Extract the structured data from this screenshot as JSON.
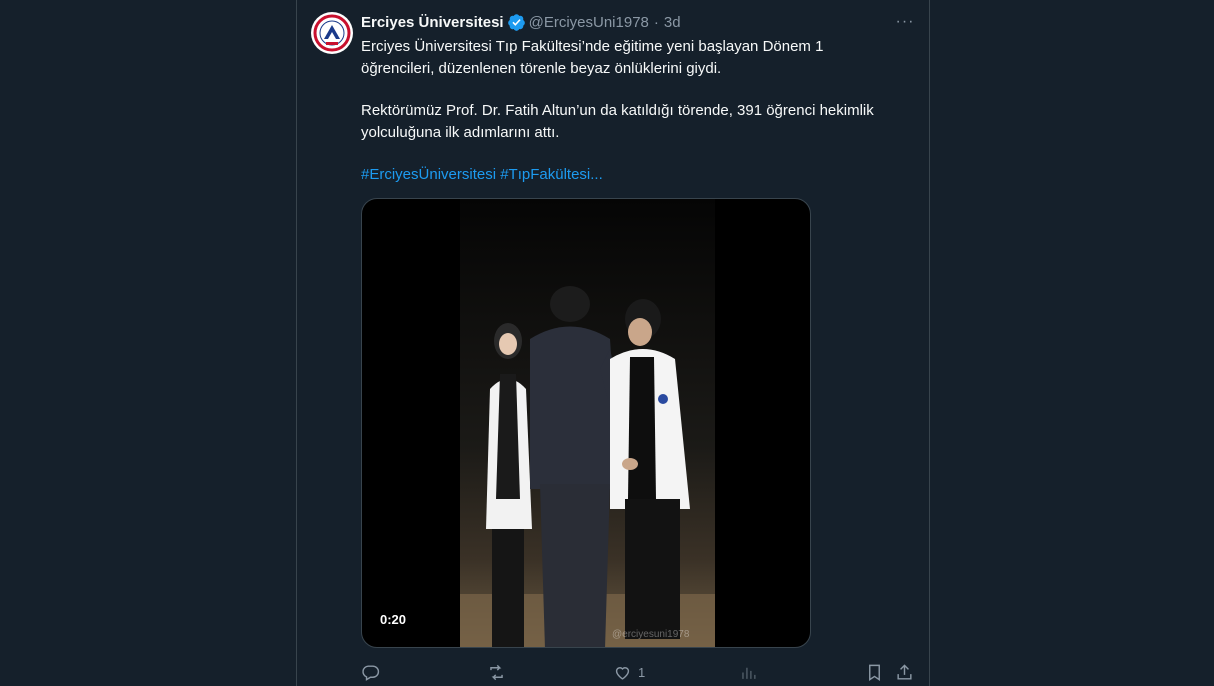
{
  "author": {
    "display_name": "Erciyes Üniversitesi",
    "handle": "@ErciyesUni1978",
    "separator": "·",
    "time": "3d",
    "verified": true
  },
  "tweet": {
    "paragraph_1": "Erciyes Üniversitesi Tıp Fakültesi’nde eğitime yeni başlayan Dönem 1 öğrencileri, düzenlenen törenle beyaz önlüklerini giydi.",
    "paragraph_2": "Rektörümüz Prof. Dr. Fatih Altun’un da katıldığı törende, 391 öğrenci hekimlik yolculuğuna ilk adımlarını attı.",
    "hashtag_1": "#ErciyesÜniversitesi",
    "hashtag_2": "#TıpFakültesi",
    "truncation": "..."
  },
  "media": {
    "duration": "0:20",
    "watermark": "@erciyesuni1978"
  },
  "actions": {
    "reply_icon": "reply-icon",
    "retweet_icon": "retweet-icon",
    "like_icon": "heart-icon",
    "like_count": "1",
    "views_icon": "analytics-icon",
    "bookmark_icon": "bookmark-icon",
    "share_icon": "share-icon"
  },
  "more_label": "···",
  "colors": {
    "background": "#15202b",
    "accent": "#1d9bf0",
    "muted": "#8b98a5"
  }
}
